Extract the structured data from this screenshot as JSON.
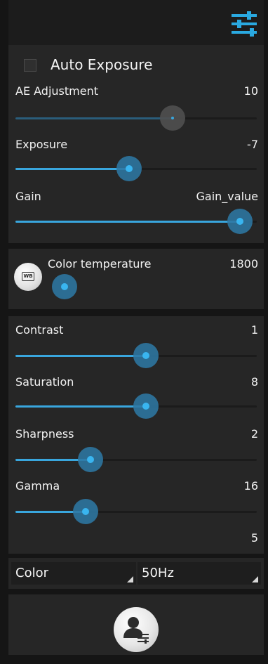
{
  "header": {
    "menu_icon": "sliders-menu-icon",
    "accent_color": "#39a6dd"
  },
  "exposure_panel": {
    "auto_exposure": {
      "label": "Auto Exposure",
      "checked": false
    },
    "ae_adjustment": {
      "label": "AE Adjustment",
      "value": "10",
      "level_percent": 65,
      "enabled": false
    },
    "exposure": {
      "label": "Exposure",
      "value": "-7",
      "level_percent": 47
    },
    "gain": {
      "label": "Gain",
      "value": "Gain_value",
      "level_percent": 93
    }
  },
  "white_balance_panel": {
    "wb_button_icon": "wb-icon",
    "wb_badge_text": "WB",
    "color_temperature": {
      "label": "Color temperature",
      "value": "1800",
      "level_percent": 0
    }
  },
  "image_panel": {
    "contrast": {
      "label": "Contrast",
      "value": "1",
      "level_percent": 54
    },
    "saturation": {
      "label": "Saturation",
      "value": "8",
      "level_percent": 54
    },
    "sharpness": {
      "label": "Sharpness",
      "value": "2",
      "level_percent": 31
    },
    "gamma": {
      "label": "Gamma",
      "value": "16",
      "level_percent": 29
    },
    "extra_value": "5"
  },
  "dropdowns": {
    "color_mode": "Color",
    "power_frequency": "50Hz"
  },
  "footer": {
    "user_settings_icon": "user-settings-icon"
  }
}
